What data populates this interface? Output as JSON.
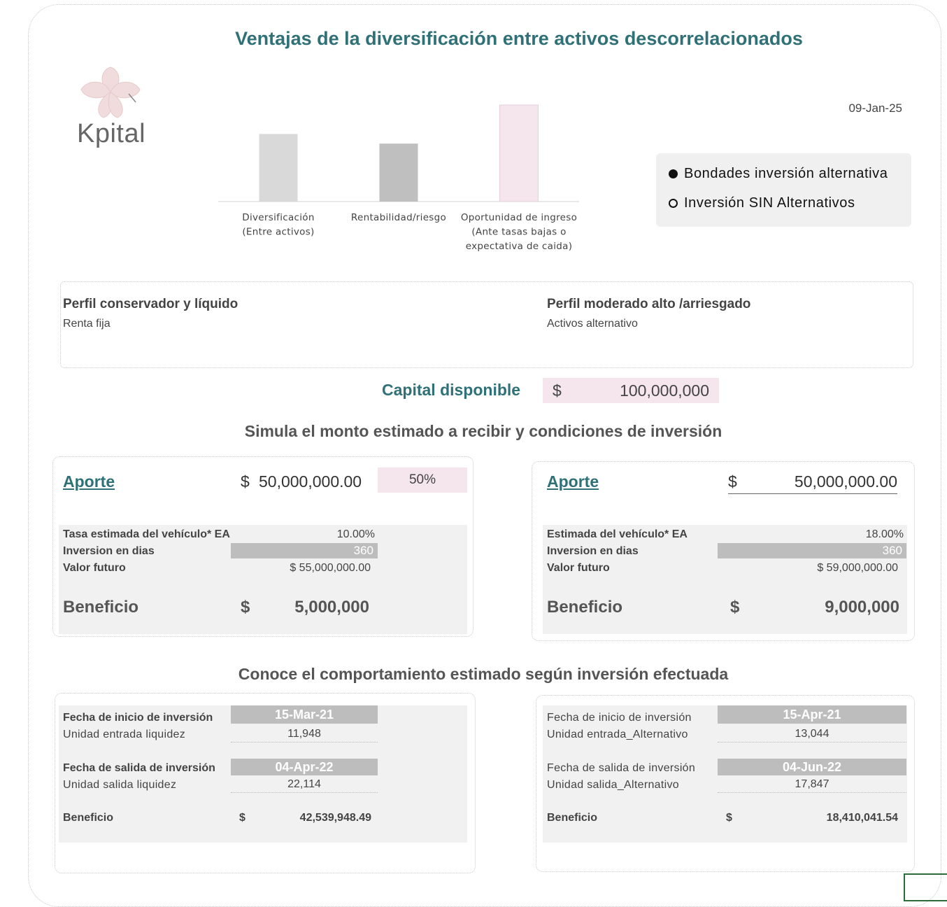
{
  "header": {
    "title": "Ventajas de la diversificación entre activos descorrelacionados",
    "date": "09-Jan-25"
  },
  "logo": {
    "name": "Kpital",
    "icon": "flower-logo-icon"
  },
  "legend": {
    "items": [
      {
        "label": "Bondades inversión alternativa",
        "selected": true
      },
      {
        "label": "Inversión SIN Alternativos",
        "selected": false
      }
    ]
  },
  "chart_data": {
    "type": "bar",
    "categories": [
      "Diversificación (Entre activos)",
      "Rentabilidad/riesgo",
      "Oportunidad de ingreso (Ante tasas bajas o expectativa de caida)"
    ],
    "category_lines": [
      [
        "Diversificación",
        "(Entre activos)"
      ],
      [
        "Rentabilidad/riesgo"
      ],
      [
        "Oportunidad de ingreso",
        "(Ante tasas bajas o",
        "expectativa de caida)"
      ]
    ],
    "values": [
      70,
      60,
      100
    ],
    "colors": [
      "#d9d9d9",
      "#bfbfbf",
      "#f4e6ec"
    ],
    "ylim": [
      0,
      100
    ],
    "grid": false
  },
  "profiles": {
    "left": {
      "title": "Perfil conservador y líquido",
      "subtitle": "Renta fija"
    },
    "right": {
      "title": "Perfil moderado alto /arriesgado",
      "subtitle": "Activos alternativo"
    }
  },
  "capital": {
    "label": "Capital disponible",
    "currency": "$",
    "value": "100,000,000"
  },
  "simulate": {
    "title": "Simula el monto estimado a recibir y condiciones de inversión",
    "left": {
      "aporte_label": "Aporte",
      "currency": "$",
      "aporte_value": "50,000,000.00",
      "percent": "50%",
      "rate_label": "Tasa estimada del vehículo* EA",
      "rate_value": "10.00%",
      "days_label": "Inversion en dias",
      "days_value": "360",
      "future_label": "Valor futuro",
      "future_value": "$ 55,000,000.00",
      "benefit_label": "Beneficio",
      "benefit_currency": "$",
      "benefit_value": "5,000,000"
    },
    "right": {
      "aporte_label": "Aporte",
      "currency": "$",
      "aporte_value": "50,000,000.00",
      "rate_label": "Estimada del vehículo* EA",
      "rate_value": "18.00%",
      "days_label": "Inversion en dias",
      "days_value": "360",
      "future_label": "Valor futuro",
      "future_value": "$ 59,000,000.00",
      "benefit_label": "Beneficio",
      "benefit_currency": "$",
      "benefit_value": "9,000,000"
    }
  },
  "behavior": {
    "title": "Conoce el comportamiento estimado según inversión efectuada",
    "left": {
      "start_label": "Fecha de inicio de inversión",
      "start_date": "15-Mar-21",
      "unit_in_label": "Unidad entrada liquidez",
      "unit_in_value": "11,948",
      "end_label": "Fecha de salida de inversión",
      "end_date": "04-Apr-22",
      "unit_out_label": "Unidad salida liquidez",
      "unit_out_value": "22,114",
      "benefit_label": "Beneficio",
      "currency": "$",
      "benefit_value": "42,539,948.49"
    },
    "right": {
      "start_label": "Fecha de inicio de inversión",
      "start_date": "15-Apr-21",
      "unit_in_label": "Unidad entrada_Alternativo",
      "unit_in_value": "13,044",
      "end_label": "Fecha de salida de inversión",
      "end_date": "04-Jun-22",
      "unit_out_label": "Unidad salida_Alternativo",
      "unit_out_value": "17,847",
      "benefit_label": "Beneficio",
      "currency": "$",
      "benefit_value": "18,410,041.54"
    }
  }
}
